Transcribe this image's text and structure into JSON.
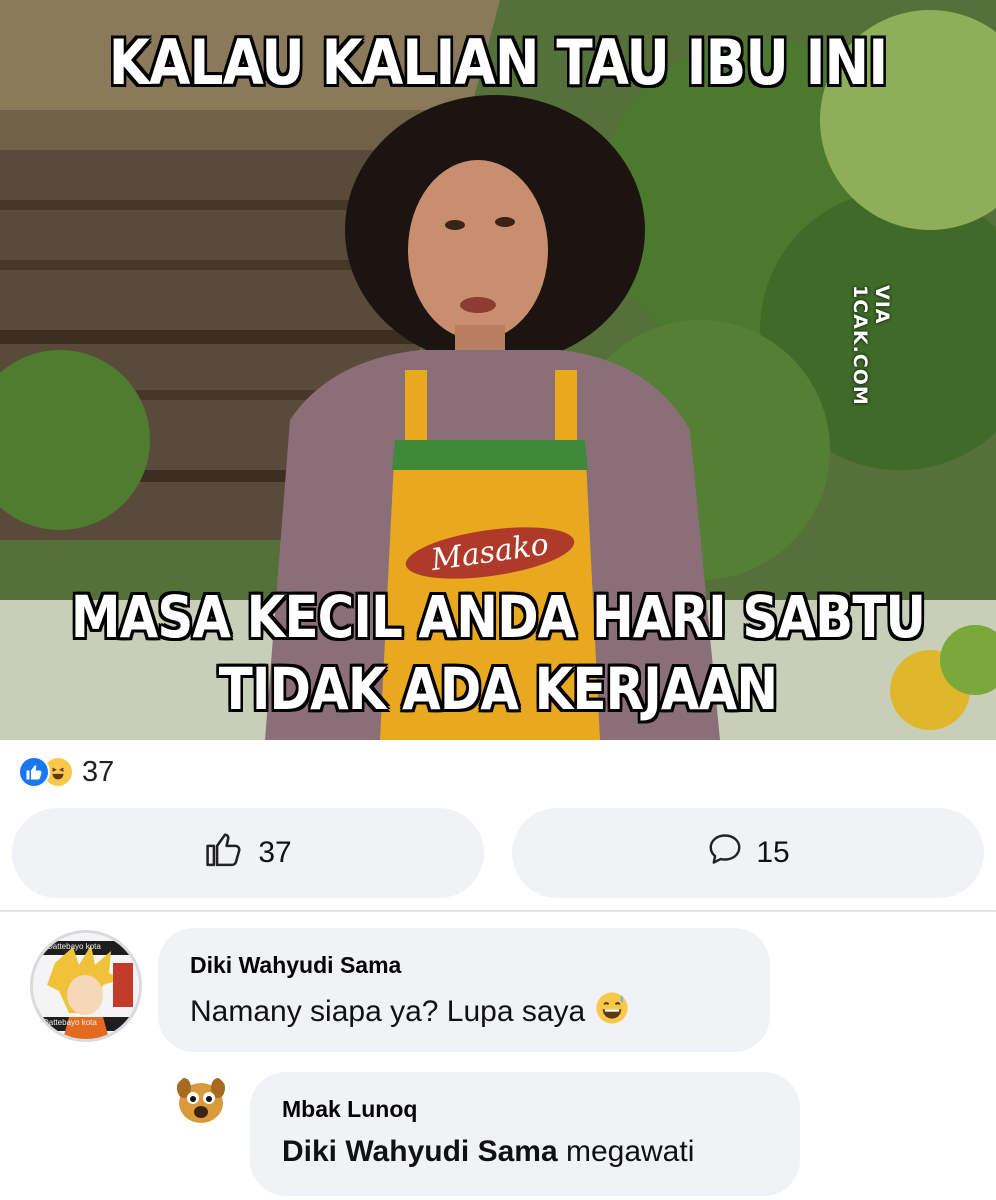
{
  "meme": {
    "caption_top": "KALAU KALIAN TAU IBU INI",
    "caption_bottom_line1": "MASA KECIL ANDA HARI SABTU",
    "caption_bottom_line2": "TIDAK ADA KERJAAN",
    "watermark": "VIA 1CAK.COM",
    "apron_brand": "Masako"
  },
  "reactions": {
    "icons": [
      "like-icon",
      "haha-icon"
    ],
    "count": "37"
  },
  "actions": {
    "like_count": "37",
    "comment_count": "15"
  },
  "comments": [
    {
      "author": "Diki Wahyudi Sama",
      "text": "Namany siapa ya?  Lupa saya",
      "emoji": "grinning-sweat-emoji",
      "avatar_label_top": "Dattebayo kota",
      "avatar_label_bottom": "Dattebayo kota"
    },
    {
      "author": "Mbak Lunoq",
      "mention": "Diki Wahyudi Sama",
      "text": "megawati"
    }
  ],
  "colors": {
    "facebook_blue": "#1877f2",
    "bubble_gray": "#f0f2f5",
    "caption_white": "#ffffff"
  }
}
